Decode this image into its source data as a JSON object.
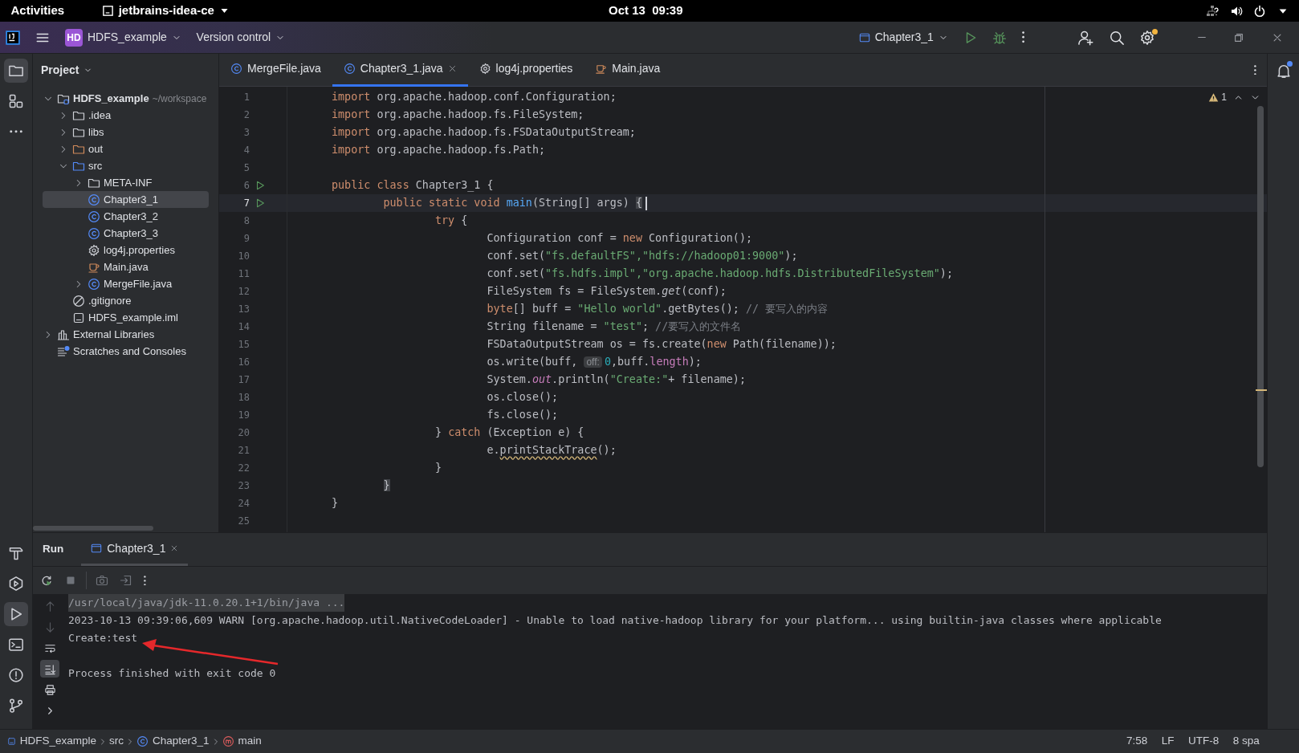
{
  "os_bar": {
    "activities": "Activities",
    "app": "jetbrains-idea-ce",
    "clock": "Oct 13  09:39"
  },
  "title_bar": {
    "project_badge": "HD",
    "project": "HDFS_example",
    "vcs": "Version control",
    "run_config": "Chapter3_1"
  },
  "tool_strip": {
    "top": [
      {
        "kind": "project",
        "selected": true
      },
      {
        "kind": "structure",
        "selected": false
      },
      {
        "kind": "more",
        "selected": false
      }
    ],
    "bottom": [
      {
        "kind": "build",
        "selected": false
      },
      {
        "kind": "services",
        "selected": false
      },
      {
        "kind": "run",
        "selected": true
      },
      {
        "kind": "terminal",
        "selected": false
      },
      {
        "kind": "problems",
        "selected": false
      },
      {
        "kind": "git",
        "selected": false
      }
    ]
  },
  "project_panel": {
    "title": "Project",
    "tree": [
      {
        "label": "HDFS_example",
        "hint": "~/workspace",
        "kind": "module",
        "expanded": true,
        "selected": false,
        "children": [
          {
            "label": ".idea",
            "kind": "folder",
            "expanded": false,
            "selected": false
          },
          {
            "label": "libs",
            "kind": "folder",
            "expanded": false,
            "selected": false
          },
          {
            "label": "out",
            "kind": "excluded",
            "expanded": false,
            "selected": false
          },
          {
            "label": "src",
            "kind": "source",
            "expanded": true,
            "selected": false,
            "children": [
              {
                "label": "META-INF",
                "kind": "folder",
                "expanded": false,
                "selected": false
              },
              {
                "label": "Chapter3_1",
                "kind": "class",
                "selected": true
              },
              {
                "label": "Chapter3_2",
                "kind": "class",
                "selected": false
              },
              {
                "label": "Chapter3_3",
                "kind": "class",
                "selected": false
              },
              {
                "label": "log4j.properties",
                "kind": "properties",
                "selected": false
              },
              {
                "label": "Main.java",
                "kind": "java",
                "selected": false
              },
              {
                "label": "MergeFile.java",
                "kind": "class",
                "expanded": false,
                "selected": false
              }
            ]
          },
          {
            "label": ".gitignore",
            "kind": "ignore",
            "selected": false
          },
          {
            "label": "HDFS_example.iml",
            "kind": "iml",
            "selected": false
          }
        ]
      },
      {
        "label": "External Libraries",
        "kind": "libraries",
        "expanded": false,
        "selected": false
      },
      {
        "label": "Scratches and Consoles",
        "kind": "scratches",
        "selected": false
      }
    ]
  },
  "editor": {
    "tabs": [
      {
        "label": "MergeFile.java",
        "kind": "class",
        "selected": false
      },
      {
        "label": "Chapter3_1.java",
        "kind": "class",
        "selected": true
      },
      {
        "label": "log4j.properties",
        "kind": "properties",
        "selected": false
      },
      {
        "label": "Main.java",
        "kind": "java",
        "selected": false
      }
    ],
    "warnings": "1",
    "lines": [
      {
        "number": "1",
        "tokens": [
          {
            "kind": "keyword",
            "text": "import"
          },
          {
            "kind": "plain",
            "text": " org.apache.hadoop.conf.Configuration;"
          }
        ]
      },
      {
        "number": "2",
        "tokens": [
          {
            "kind": "keyword",
            "text": "import"
          },
          {
            "kind": "plain",
            "text": " org.apache.hadoop.fs.FileSystem;"
          }
        ]
      },
      {
        "number": "3",
        "tokens": [
          {
            "kind": "keyword",
            "text": "import"
          },
          {
            "kind": "plain",
            "text": " org.apache.hadoop.fs.FSDataOutputStream;"
          }
        ]
      },
      {
        "number": "4",
        "tokens": [
          {
            "kind": "keyword",
            "text": "import"
          },
          {
            "kind": "plain",
            "text": " org.apache.hadoop.fs.Path;"
          }
        ]
      },
      {
        "number": "5"
      },
      {
        "number": "6",
        "run": true,
        "tokens": [
          {
            "kind": "keyword",
            "text": "public class"
          },
          {
            "kind": "plain",
            "text": " Chapter3_1 {"
          }
        ]
      },
      {
        "number": "7",
        "run": true,
        "current": true,
        "caret": true,
        "tokens": [
          {
            "kind": "keyword",
            "text": "        public static void "
          },
          {
            "kind": "declaration",
            "text": "main"
          },
          {
            "kind": "plain",
            "text": "(String[] args) "
          },
          {
            "kind": "brace",
            "text": "{"
          }
        ]
      },
      {
        "number": "8",
        "tokens": [
          {
            "kind": "keyword",
            "text": "                try"
          },
          {
            "kind": "plain",
            "text": " {"
          }
        ]
      },
      {
        "number": "9",
        "tokens": [
          {
            "kind": "plain",
            "text": "                        Configuration conf = "
          },
          {
            "kind": "keyword",
            "text": "new"
          },
          {
            "kind": "plain",
            "text": " Configuration();"
          }
        ]
      },
      {
        "number": "10",
        "tokens": [
          {
            "kind": "plain",
            "text": "                        conf.set("
          },
          {
            "kind": "string",
            "text": "\"fs.defaultFS\","
          },
          {
            "kind": "string",
            "text": "\"hdfs://hadoop01:9000\""
          },
          {
            "kind": "plain",
            "text": ");"
          }
        ]
      },
      {
        "number": "11",
        "tokens": [
          {
            "kind": "plain",
            "text": "                        conf.set("
          },
          {
            "kind": "string",
            "text": "\"fs.hdfs.impl\","
          },
          {
            "kind": "string",
            "text": "\"org.apache.hadoop.hdfs.DistributedFileSystem\""
          },
          {
            "kind": "plain",
            "text": ");"
          }
        ]
      },
      {
        "number": "12",
        "tokens": [
          {
            "kind": "plain",
            "text": "                        FileSystem fs = FileSystem."
          },
          {
            "kind": "static",
            "text": "get"
          },
          {
            "kind": "plain",
            "text": "(conf);"
          }
        ]
      },
      {
        "number": "13",
        "tokens": [
          {
            "kind": "keyword",
            "text": "                        byte"
          },
          {
            "kind": "plain",
            "text": "[] buff = "
          },
          {
            "kind": "string",
            "text": "\"Hello world\""
          },
          {
            "kind": "plain",
            "text": ".getBytes(); "
          },
          {
            "kind": "comment",
            "text": "// 要写入的内容"
          }
        ]
      },
      {
        "number": "14",
        "tokens": [
          {
            "kind": "plain",
            "text": "                        String filename = "
          },
          {
            "kind": "string",
            "text": "\"test\""
          },
          {
            "kind": "plain",
            "text": "; "
          },
          {
            "kind": "comment",
            "text": "//要写入的文件名"
          }
        ]
      },
      {
        "number": "15",
        "tokens": [
          {
            "kind": "plain",
            "text": "                        FSDataOutputStream os = fs.create("
          },
          {
            "kind": "keyword",
            "text": "new"
          },
          {
            "kind": "plain",
            "text": " Path(filename));"
          }
        ]
      },
      {
        "number": "16",
        "tokens": [
          {
            "kind": "plain",
            "text": "                        os.write(buff, "
          },
          {
            "kind": "hint",
            "text": "off:"
          },
          {
            "kind": "number",
            "text": "0"
          },
          {
            "kind": "plain",
            "text": ",buff."
          },
          {
            "kind": "field",
            "text": "length"
          },
          {
            "kind": "plain",
            "text": ");"
          }
        ]
      },
      {
        "number": "17",
        "tokens": [
          {
            "kind": "plain",
            "text": "                        System."
          },
          {
            "kind": "static-field",
            "text": "out"
          },
          {
            "kind": "plain",
            "text": ".println("
          },
          {
            "kind": "string",
            "text": "\"Create:\""
          },
          {
            "kind": "plain",
            "text": "+ filename);"
          }
        ]
      },
      {
        "number": "18",
        "tokens": [
          {
            "kind": "plain",
            "text": "                        os.close();"
          }
        ]
      },
      {
        "number": "19",
        "tokens": [
          {
            "kind": "plain",
            "text": "                        fs.close();"
          }
        ]
      },
      {
        "number": "20",
        "tokens": [
          {
            "kind": "plain",
            "text": "                } "
          },
          {
            "kind": "keyword",
            "text": "catch"
          },
          {
            "kind": "plain",
            "text": " (Exception e) {"
          }
        ]
      },
      {
        "number": "21",
        "tokens": [
          {
            "kind": "plain",
            "text": "                        e."
          },
          {
            "kind": "warning",
            "text": "printStackTrace"
          },
          {
            "kind": "plain",
            "text": "();"
          }
        ]
      },
      {
        "number": "22",
        "tokens": [
          {
            "kind": "plain",
            "text": "                }"
          }
        ]
      },
      {
        "number": "23",
        "tokens": [
          {
            "kind": "brace",
            "text": "        }"
          }
        ]
      },
      {
        "number": "24",
        "tokens": [
          {
            "kind": "plain",
            "text": "}"
          }
        ]
      },
      {
        "number": "25"
      }
    ]
  },
  "run_panel": {
    "title": "Run",
    "tabs": [
      {
        "label": "Chapter3_1",
        "selected": true
      }
    ],
    "toolbar": [
      {
        "kind": "rerun",
        "disabled": false
      },
      {
        "kind": "stop",
        "disabled": true
      },
      {
        "kind": "camera",
        "disabled": true
      },
      {
        "kind": "exit",
        "disabled": true
      },
      {
        "kind": "more",
        "disabled": false
      }
    ],
    "gutter": [
      {
        "kind": "up",
        "disabled": true,
        "selected": false
      },
      {
        "kind": "down",
        "disabled": true,
        "selected": false
      },
      {
        "kind": "wrap",
        "disabled": false,
        "selected": false
      },
      {
        "kind": "scroll-end",
        "disabled": false,
        "selected": true
      },
      {
        "kind": "print",
        "disabled": false,
        "selected": false
      },
      {
        "kind": "expand",
        "disabled": false,
        "selected": false
      }
    ],
    "console": [
      {
        "kind": "command",
        "text": "/usr/local/java/jdk-11.0.20.1+1/bin/java ..."
      },
      {
        "kind": "output",
        "text": "2023-10-13 09:39:06,609 WARN [org.apache.hadoop.util.NativeCodeLoader] - Unable to load native-hadoop library for your platform... using builtin-java classes where applicable"
      },
      {
        "kind": "output",
        "text": "Create:test"
      },
      {
        "kind": "exit",
        "text": "Process finished with exit code 0"
      }
    ],
    "annotation": {
      "kind": "arrow"
    }
  },
  "notifications": {
    "unread": true
  },
  "status_bar": {
    "breadcrumbs": [
      {
        "kind": "module",
        "label": "HDFS_example"
      },
      {
        "kind": "folder",
        "label": "src"
      },
      {
        "kind": "class",
        "label": "Chapter3_1"
      },
      {
        "kind": "method",
        "label": "main"
      }
    ],
    "items": [
      "7:58",
      "LF",
      "UTF-8",
      "8 spa"
    ]
  }
}
